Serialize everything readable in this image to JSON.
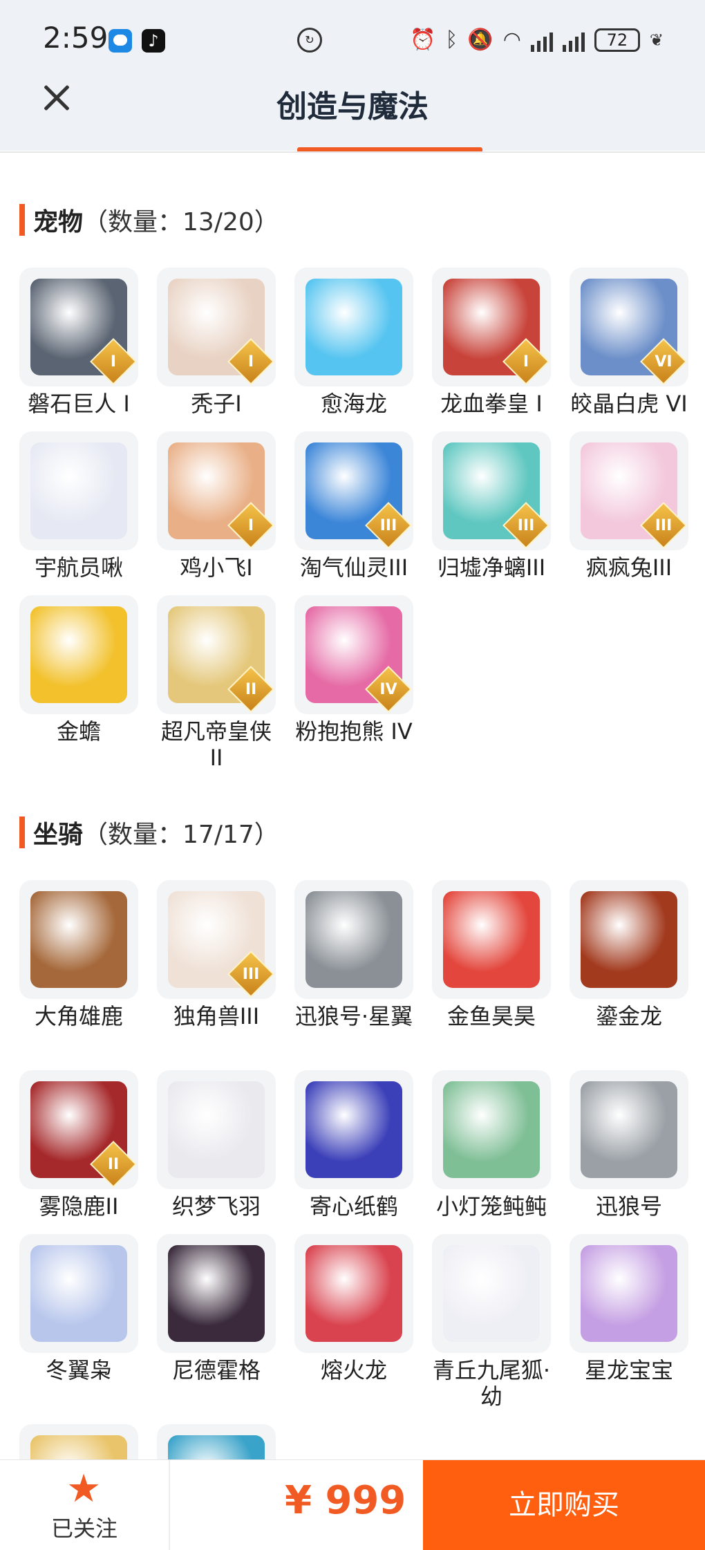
{
  "status_bar": {
    "time": "2:59",
    "battery": "72",
    "icons": [
      "chat-app-icon",
      "tiktok-icon",
      "data-saver-icon",
      "alarm-icon",
      "bluetooth-icon",
      "mute-icon",
      "wifi-icon",
      "signal-icon",
      "signal-icon",
      "battery-icon",
      "leaf-icon"
    ]
  },
  "header": {
    "title": "创造与魔法"
  },
  "pets": {
    "name": "宠物",
    "count": "（数量：13/20）",
    "items": [
      {
        "name": "磐石巨人 I",
        "badge": "I",
        "color": "#5a6472"
      },
      {
        "name": "秃子I",
        "badge": "I",
        "color": "#e8d2c3"
      },
      {
        "name": "愈海龙",
        "badge": "",
        "color": "#55c4f0"
      },
      {
        "name": "龙血拳皇 I",
        "badge": "I",
        "color": "#c8433a"
      },
      {
        "name": "皎晶白虎 VI",
        "badge": "VI",
        "color": "#6c8fc9"
      },
      {
        "name": "宇航员啾",
        "badge": "",
        "color": "#e6e9f3"
      },
      {
        "name": "鸡小飞I",
        "badge": "I",
        "color": "#e9b088"
      },
      {
        "name": "淘气仙灵III",
        "badge": "III",
        "color": "#3c86d8"
      },
      {
        "name": "归墟净螭III",
        "badge": "III",
        "color": "#5fc7c0"
      },
      {
        "name": "疯疯兔III",
        "badge": "III",
        "color": "#f3c8dc"
      },
      {
        "name": "金蟾",
        "badge": "",
        "color": "#f2c12c"
      },
      {
        "name": "超凡帝皇侠II",
        "badge": "II",
        "color": "#e4c77a"
      },
      {
        "name": "粉抱抱熊 IV",
        "badge": "IV",
        "color": "#e56aa5"
      }
    ]
  },
  "mounts": {
    "name": "坐骑",
    "count": "（数量：17/17）",
    "items": [
      {
        "name": "大角雄鹿",
        "badge": "",
        "color": "#a5683a"
      },
      {
        "name": "独角兽III",
        "badge": "III",
        "color": "#efe1d6"
      },
      {
        "name": "迅狼号·星翼",
        "badge": "",
        "color": "#8a9096"
      },
      {
        "name": "金鱼昊昊",
        "badge": "",
        "color": "#e3463c"
      },
      {
        "name": "鎏金龙",
        "badge": "",
        "color": "#a23a1e"
      },
      {
        "name": "雾隐鹿II",
        "badge": "II",
        "color": "#a5282a"
      },
      {
        "name": "织梦飞羽",
        "badge": "",
        "color": "#e9e9ee"
      },
      {
        "name": "寄心纸鹤",
        "badge": "",
        "color": "#3b3fb8"
      },
      {
        "name": "小灯笼鲀鲀",
        "badge": "",
        "color": "#7fbf96"
      },
      {
        "name": "迅狼号",
        "badge": "",
        "color": "#9aa0a6"
      },
      {
        "name": "冬翼枭",
        "badge": "",
        "color": "#b8c6ec"
      },
      {
        "name": "尼德霍格",
        "badge": "",
        "color": "#3a2a3c"
      },
      {
        "name": "熔火龙",
        "badge": "",
        "color": "#d9434f"
      },
      {
        "name": "青丘九尾狐·幼",
        "badge": "",
        "color": "#eeeef5"
      },
      {
        "name": "星龙宝宝",
        "badge": "",
        "color": "#c59fe3"
      },
      {
        "name": "",
        "badge": "",
        "color": "#e9c46a"
      },
      {
        "name": "",
        "badge": "",
        "color": "#3aa3c9"
      }
    ]
  },
  "bottom": {
    "follow_label": "已关注",
    "price": "¥ 999",
    "buy_label": "立即购买"
  },
  "colors": {
    "accent": "#f15a22",
    "buy_button": "#ff5f0f"
  }
}
